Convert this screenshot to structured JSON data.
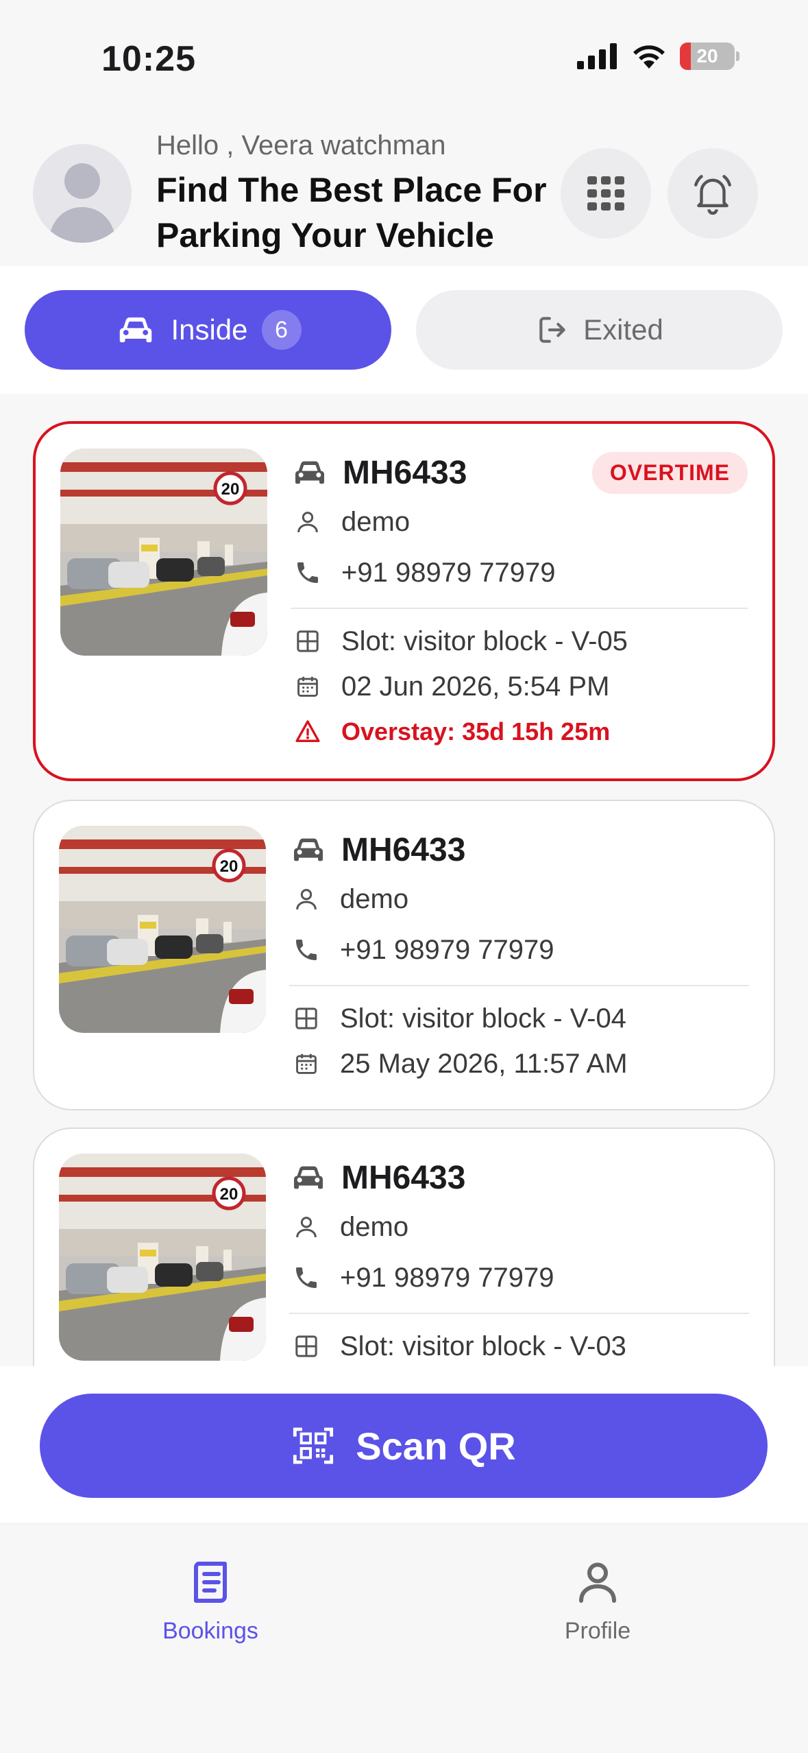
{
  "status": {
    "time": "10:25",
    "battery": "20"
  },
  "header": {
    "greeting": "Hello , Veera watchman",
    "title": "Find The Best Place For Parking Your Vehicle"
  },
  "tabs": {
    "inside_label": "Inside",
    "inside_count": "6",
    "exited_label": "Exited"
  },
  "bookings": [
    {
      "plate": "MH6433",
      "badge": "OVERTIME",
      "name": "demo",
      "phone": "+91 98979 77979",
      "slot": "Slot: visitor block - V-05",
      "datetime": "02 Jun 2026, 5:54 PM",
      "overstay": "Overstay: 35d 15h 25m"
    },
    {
      "plate": "MH6433",
      "name": "demo",
      "phone": "+91 98979 77979",
      "slot": "Slot: visitor block - V-04",
      "datetime": "25 May 2026, 11:57 AM"
    },
    {
      "plate": "MH6433",
      "name": "demo",
      "phone": "+91 98979 77979",
      "slot": "Slot: visitor block - V-03"
    }
  ],
  "scan": {
    "label": "Scan QR"
  },
  "nav": {
    "bookings": "Bookings",
    "profile": "Profile"
  },
  "colors": {
    "accent": "#5b52e8",
    "danger": "#d9121f"
  }
}
